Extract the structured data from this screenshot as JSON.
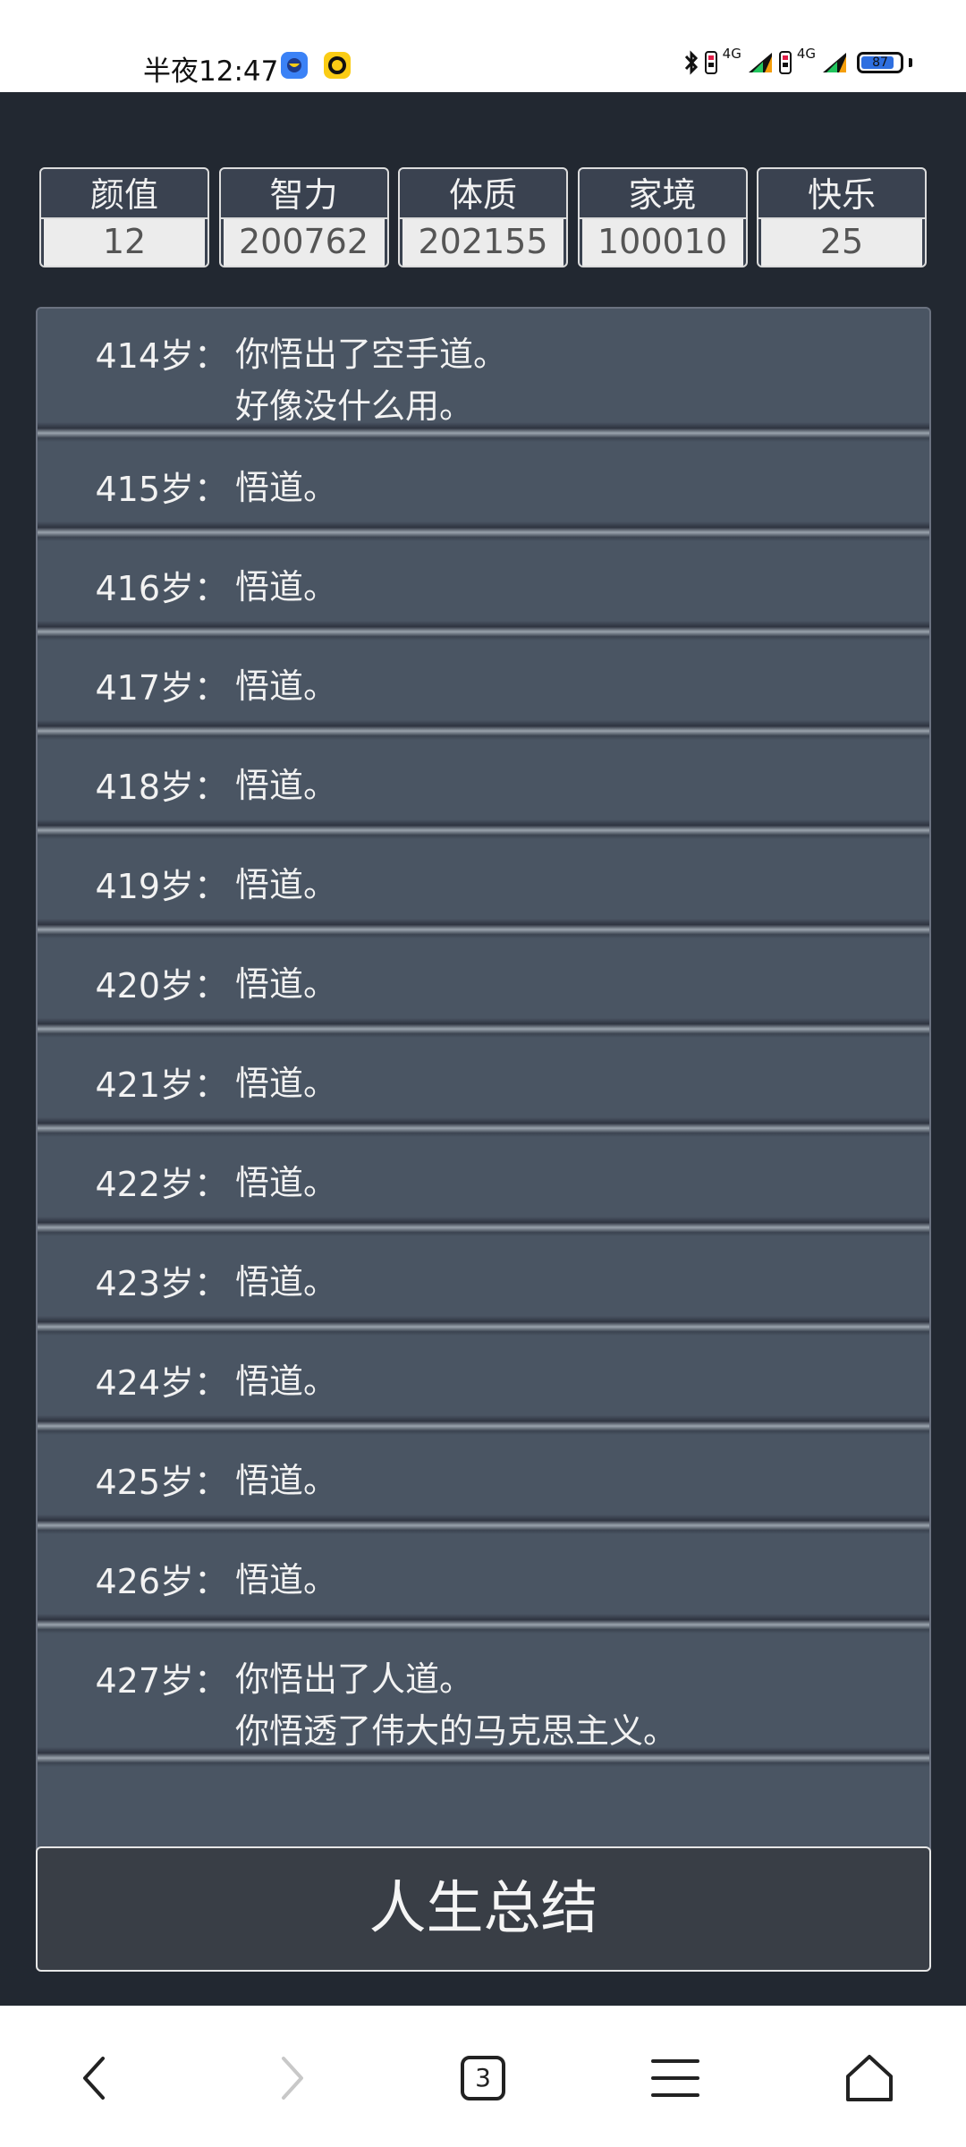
{
  "status_bar": {
    "time": "半夜12:47",
    "network_1": "4G",
    "network_2": "4G",
    "battery": "87",
    "battery_level": 0.87
  },
  "stats": [
    {
      "label": "颜值",
      "value": "12"
    },
    {
      "label": "智力",
      "value": "200762"
    },
    {
      "label": "体质",
      "value": "202155"
    },
    {
      "label": "家境",
      "value": "100010"
    },
    {
      "label": "快乐",
      "value": "25"
    }
  ],
  "log": [
    {
      "age": "414岁：",
      "lines": [
        "你悟出了空手道。",
        "好像没什么用。"
      ]
    },
    {
      "age": "415岁：",
      "lines": [
        "悟道。"
      ]
    },
    {
      "age": "416岁：",
      "lines": [
        "悟道。"
      ]
    },
    {
      "age": "417岁：",
      "lines": [
        "悟道。"
      ]
    },
    {
      "age": "418岁：",
      "lines": [
        "悟道。"
      ]
    },
    {
      "age": "419岁：",
      "lines": [
        "悟道。"
      ]
    },
    {
      "age": "420岁：",
      "lines": [
        "悟道。"
      ]
    },
    {
      "age": "421岁：",
      "lines": [
        "悟道。"
      ]
    },
    {
      "age": "422岁：",
      "lines": [
        "悟道。"
      ]
    },
    {
      "age": "423岁：",
      "lines": [
        "悟道。"
      ]
    },
    {
      "age": "424岁：",
      "lines": [
        "悟道。"
      ]
    },
    {
      "age": "425岁：",
      "lines": [
        "悟道。"
      ]
    },
    {
      "age": "426岁：",
      "lines": [
        "悟道。"
      ]
    },
    {
      "age": "427岁：",
      "lines": [
        "你悟出了人道。",
        "你悟透了伟大的马克思主义。"
      ]
    }
  ],
  "summary_button": "人生总结",
  "nav": {
    "tab_count": "3",
    "icons": [
      "back-arrow-icon",
      "forward-arrow-icon",
      "tabs-icon",
      "menu-icon",
      "home-icon"
    ]
  },
  "colors": {
    "app_bg": "#222831",
    "panel_bg": "#4a5563",
    "battery_fill": "#2f6fe0"
  }
}
